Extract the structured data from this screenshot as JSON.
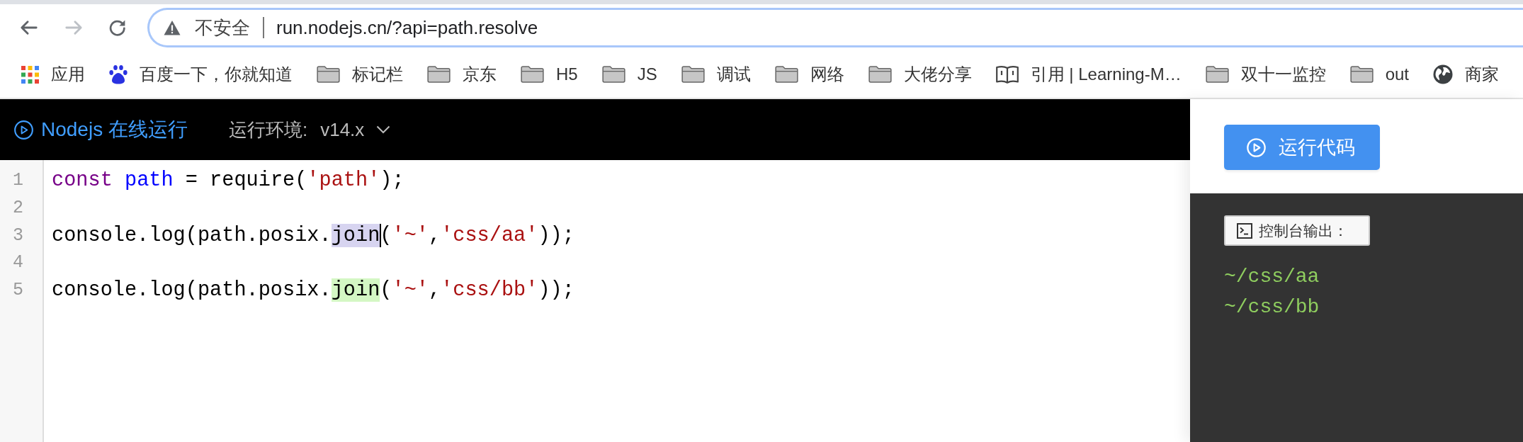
{
  "nav_buttons": [
    {
      "kind": "back",
      "disabled": false
    },
    {
      "kind": "forward",
      "disabled": true
    },
    {
      "kind": "reload",
      "disabled": false
    }
  ],
  "address_bar": {
    "focused": true,
    "security_label": "不安全",
    "url": "run.nodejs.cn/?api=path.resolve"
  },
  "bookmarks": [
    {
      "kind": "apps",
      "label": "应用"
    },
    {
      "kind": "paw",
      "label": "百度一下，你就知道"
    },
    {
      "kind": "folder",
      "label": "标记栏"
    },
    {
      "kind": "folder",
      "label": "京东"
    },
    {
      "kind": "folder",
      "label": "H5"
    },
    {
      "kind": "folder",
      "label": "JS"
    },
    {
      "kind": "folder",
      "label": "调试"
    },
    {
      "kind": "folder",
      "label": "网络"
    },
    {
      "kind": "folder",
      "label": "大佬分享"
    },
    {
      "kind": "book",
      "label": "引用 | Learning-M…"
    },
    {
      "kind": "folder",
      "label": "双十一监控"
    },
    {
      "kind": "folder",
      "label": "out"
    },
    {
      "kind": "globe",
      "label": "商家"
    }
  ],
  "app_header": {
    "title": "Nodejs 在线运行",
    "runtime_label": "运行环境:",
    "runtime_value": "v14.x"
  },
  "editor": {
    "lines": [
      {
        "number": "1",
        "tokens": [
          {
            "text": "const ",
            "kind": "keyword"
          },
          {
            "text": "path",
            "kind": "def"
          },
          {
            "text": " = require(",
            "kind": "plain"
          },
          {
            "text": "'path'",
            "kind": "string"
          },
          {
            "text": ");",
            "kind": "plain"
          }
        ]
      },
      {
        "number": "2"
      },
      {
        "number": "3",
        "tokens": [
          {
            "text": "console.log(path.posix.",
            "kind": "plain"
          },
          {
            "text": "join",
            "kind": "plain",
            "in_selection": true,
            "cursor": true
          },
          {
            "text": "(",
            "kind": "plain"
          },
          {
            "text": "'~'",
            "kind": "string"
          },
          {
            "text": ",",
            "kind": "plain"
          },
          {
            "text": "'css/aa'",
            "kind": "string"
          },
          {
            "text": "));",
            "kind": "plain"
          }
        ]
      },
      {
        "number": "4"
      },
      {
        "number": "5",
        "tokens": [
          {
            "text": "console.log(path.posix.",
            "kind": "plain"
          },
          {
            "text": "join",
            "kind": "plain",
            "matched": true
          },
          {
            "text": "(",
            "kind": "plain"
          },
          {
            "text": "'~'",
            "kind": "string"
          },
          {
            "text": ",",
            "kind": "plain"
          },
          {
            "text": "'css/bb'",
            "kind": "string"
          },
          {
            "text": "));",
            "kind": "plain"
          }
        ]
      }
    ]
  },
  "run_button": {
    "label": "运行代码"
  },
  "console": {
    "title": "控制台输出：",
    "output": [
      "~/css/aa",
      "~/css/bb"
    ]
  }
}
